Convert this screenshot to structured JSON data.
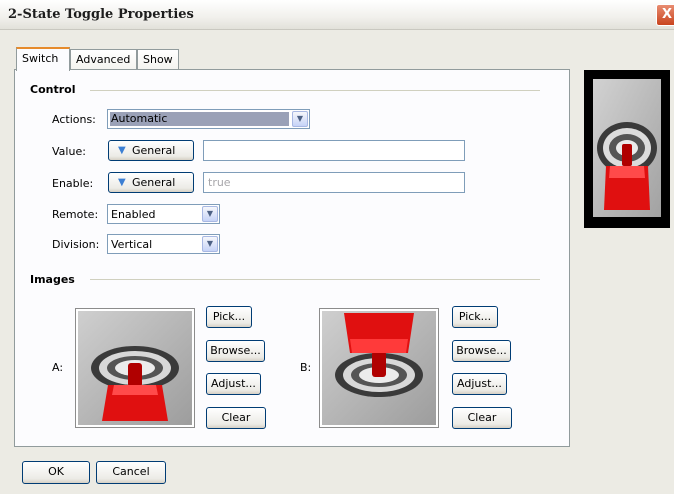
{
  "window": {
    "title": "2-State Toggle Properties",
    "close_label": "X"
  },
  "tabs": [
    {
      "label": "Switch",
      "active": true
    },
    {
      "label": "Advanced",
      "active": false
    },
    {
      "label": "Show",
      "active": false
    }
  ],
  "control": {
    "section_title": "Control",
    "actions": {
      "label": "Actions:",
      "value": "Automatic"
    },
    "value": {
      "label": "Value:",
      "mode": "General",
      "text": ""
    },
    "enable": {
      "label": "Enable:",
      "mode": "General",
      "text": "true"
    },
    "remote": {
      "label": "Remote:",
      "value": "Enabled"
    },
    "division": {
      "label": "Division:",
      "value": "Vertical"
    }
  },
  "images": {
    "section_title": "Images",
    "a": {
      "label": "A:",
      "pick": "Pick...",
      "browse": "Browse...",
      "adjust": "Adjust...",
      "clear": "Clear"
    },
    "b": {
      "label": "B:",
      "pick": "Pick...",
      "browse": "Browse...",
      "adjust": "Adjust...",
      "clear": "Clear"
    }
  },
  "footer": {
    "ok": "OK",
    "cancel": "Cancel"
  },
  "colors": {
    "accent_tab": "#e68b2c",
    "toggle_red": "#e01010",
    "button_border": "#003c74"
  },
  "icons": {
    "dropdown": "chevron-down-icon",
    "menu": "triangle-down-icon",
    "close": "close-icon"
  }
}
